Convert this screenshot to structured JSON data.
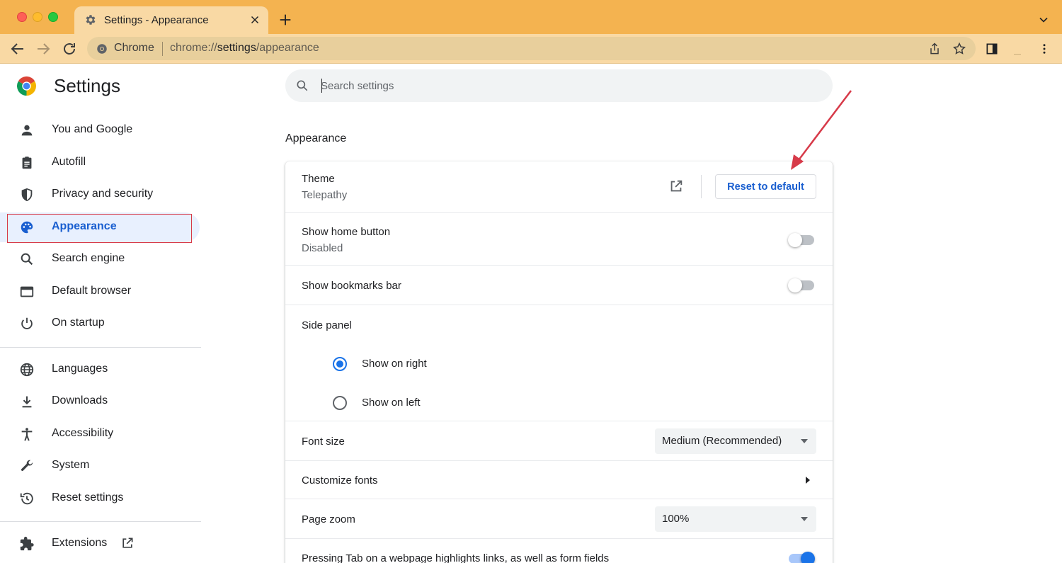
{
  "browser": {
    "tab_title": "Settings - Appearance",
    "omnibox_site_label": "Chrome",
    "url_prefix": "chrome://",
    "url_bold": "settings",
    "url_suffix": "/appearance"
  },
  "header": {
    "title": "Settings",
    "search_placeholder": "Search settings"
  },
  "sidebar": {
    "items": [
      {
        "label": "You and Google",
        "icon": "person-icon"
      },
      {
        "label": "Autofill",
        "icon": "clipboard-icon"
      },
      {
        "label": "Privacy and security",
        "icon": "shield-icon"
      },
      {
        "label": "Appearance",
        "icon": "palette-icon",
        "active": true
      },
      {
        "label": "Search engine",
        "icon": "search-icon"
      },
      {
        "label": "Default browser",
        "icon": "browser-window-icon"
      },
      {
        "label": "On startup",
        "icon": "power-icon"
      },
      {
        "label": "Languages",
        "icon": "globe-icon"
      },
      {
        "label": "Downloads",
        "icon": "download-icon"
      },
      {
        "label": "Accessibility",
        "icon": "accessibility-icon"
      },
      {
        "label": "System",
        "icon": "wrench-icon"
      },
      {
        "label": "Reset settings",
        "icon": "history-icon"
      },
      {
        "label": "Extensions",
        "icon": "puzzle-icon"
      }
    ]
  },
  "main": {
    "section_title": "Appearance",
    "theme": {
      "label": "Theme",
      "value": "Telepathy",
      "reset_label": "Reset to default"
    },
    "home_button": {
      "label": "Show home button",
      "value": "Disabled",
      "enabled": false
    },
    "bookmarks_bar": {
      "label": "Show bookmarks bar",
      "enabled": false
    },
    "side_panel": {
      "label": "Side panel",
      "options": [
        "Show on right",
        "Show on left"
      ],
      "selected": "Show on right"
    },
    "font_size": {
      "label": "Font size",
      "value": "Medium (Recommended)"
    },
    "customize_fonts": {
      "label": "Customize fonts"
    },
    "page_zoom": {
      "label": "Page zoom",
      "value": "100%"
    },
    "tab_highlight": {
      "label": "Pressing Tab on a webpage highlights links, as well as form fields",
      "enabled": true
    }
  },
  "colors": {
    "tab_strip": "#f4b350",
    "toolbar": "#f9d9a4",
    "accent": "#1a73e8",
    "annotation": "#d73a49"
  }
}
